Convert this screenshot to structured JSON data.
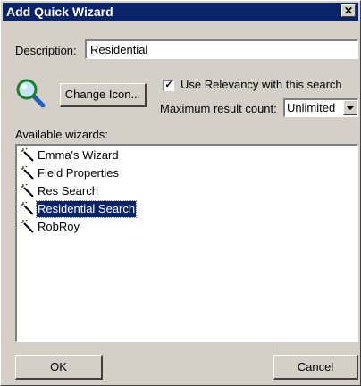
{
  "dialog": {
    "title": "Add Quick Wizard",
    "close_label": "✕"
  },
  "description": {
    "label": "Description:",
    "value": "Residential"
  },
  "icon": {
    "name": "magnifier-icon",
    "change_label": "Change Icon..."
  },
  "relevancy": {
    "label": "Use Relevancy with this search",
    "checked": true
  },
  "max_count": {
    "label": "Maximum result count:",
    "value": "Unlimited"
  },
  "wizards": {
    "label": "Available wizards:",
    "items": [
      {
        "label": "Emma's Wizard",
        "selected": false
      },
      {
        "label": "Field Properties",
        "selected": false
      },
      {
        "label": "Res Search",
        "selected": false
      },
      {
        "label": "Residential Search",
        "selected": true
      },
      {
        "label": "RobRoy",
        "selected": false
      }
    ]
  },
  "buttons": {
    "ok": "OK",
    "cancel": "Cancel"
  }
}
